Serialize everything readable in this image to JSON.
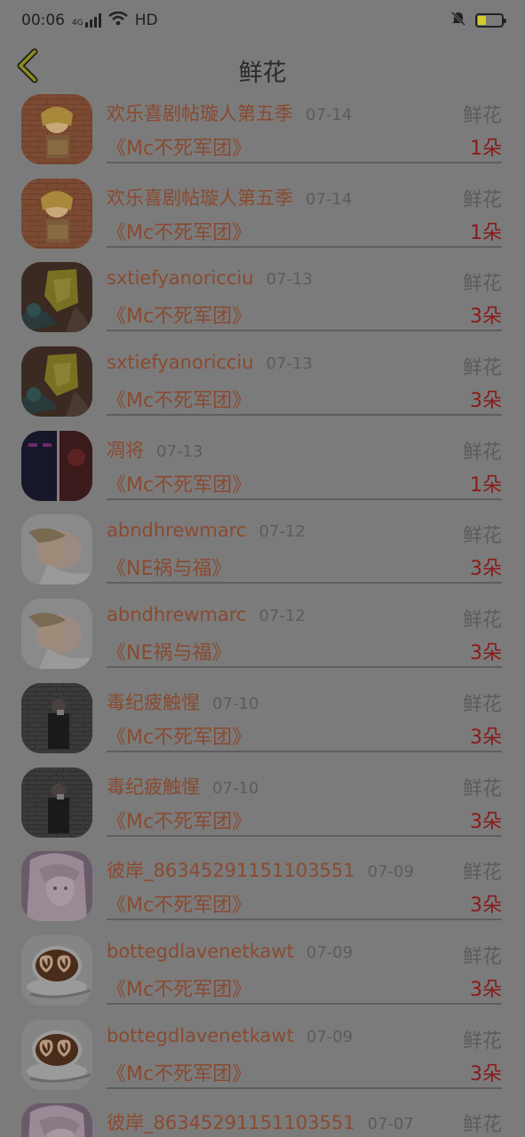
{
  "status_bar": {
    "time": "00:06",
    "network": "4G",
    "hd": "HD"
  },
  "header": {
    "title": "鲜花"
  },
  "gifts": [
    {
      "name": "欢乐喜剧帖璇人第五季",
      "date": "07-14",
      "type": "鲜花",
      "group": "《Mc不死军团》",
      "count": "1朵",
      "avatar": "anime-girl-avatar"
    },
    {
      "name": "欢乐喜剧帖璇人第五季",
      "date": "07-14",
      "type": "鲜花",
      "group": "《Mc不死军团》",
      "count": "1朵",
      "avatar": "anime-girl-avatar"
    },
    {
      "name": "sxtiefyanoricciu",
      "date": "07-13",
      "type": "鲜花",
      "group": "《Mc不死军团》",
      "count": "3朵",
      "avatar": "gold-leaf-avatar"
    },
    {
      "name": "sxtiefyanoricciu",
      "date": "07-13",
      "type": "鲜花",
      "group": "《Mc不死军团》",
      "count": "3朵",
      "avatar": "gold-leaf-avatar"
    },
    {
      "name": "凋将",
      "date": "07-13",
      "type": "鲜花",
      "group": "《Mc不死军团》",
      "count": "1朵",
      "avatar": "minecraft-enderman-avatar"
    },
    {
      "name": "abndhrewmarc",
      "date": "07-12",
      "type": "鲜花",
      "group": "《NE祸与福》",
      "count": "3朵",
      "avatar": "woman-lying-avatar"
    },
    {
      "name": "abndhrewmarc",
      "date": "07-12",
      "type": "鲜花",
      "group": "《NE祸与福》",
      "count": "3朵",
      "avatar": "woman-lying-avatar"
    },
    {
      "name": "毒纪疲触惺",
      "date": "07-10",
      "type": "鲜花",
      "group": "《Mc不死军团》",
      "count": "3朵",
      "avatar": "man-brick-wall-avatar"
    },
    {
      "name": "毒纪疲触惺",
      "date": "07-10",
      "type": "鲜花",
      "group": "《Mc不死军团》",
      "count": "3朵",
      "avatar": "man-brick-wall-avatar"
    },
    {
      "name": "彼岸_86345291151103551",
      "date": "07-09",
      "type": "鲜花",
      "group": "《Mc不死军团》",
      "count": "3朵",
      "avatar": "anime-white-hair-avatar"
    },
    {
      "name": "bottegdlavenetkawt",
      "date": "07-09",
      "type": "鲜花",
      "group": "《Mc不死军团》",
      "count": "3朵",
      "avatar": "coffee-hearts-avatar"
    },
    {
      "name": "bottegdlavenetkawt",
      "date": "07-09",
      "type": "鲜花",
      "group": "《Mc不死军团》",
      "count": "3朵",
      "avatar": "coffee-hearts-avatar"
    },
    {
      "name": "彼岸_86345291151103551",
      "date": "07-07",
      "type": "鲜花",
      "group": "",
      "count": "",
      "avatar": "anime-white-hair-avatar"
    }
  ]
}
